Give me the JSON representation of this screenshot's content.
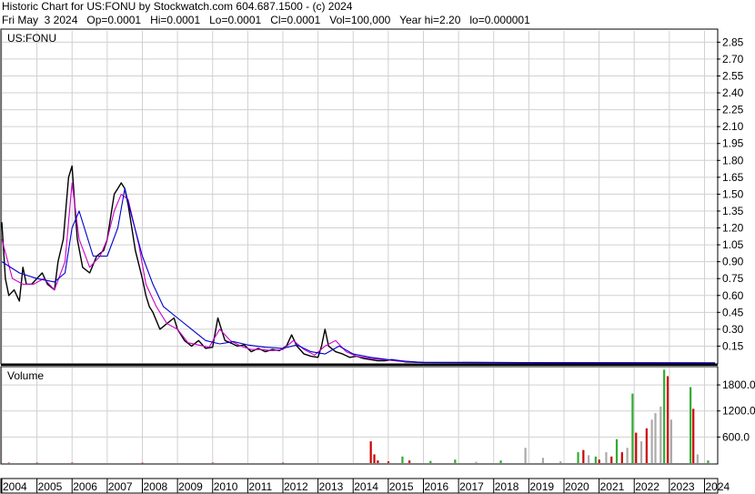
{
  "header": {
    "line1": "Historic Chart for US:FONU by Stockwatch.com 604.687.1500 - (c) 2024",
    "line2": "Fri May  3 2024   Op=0.0001   Hi=0.0001   Lo=0.0001   Cl=0.0001   Vol=100,000   Year hi=2.20   lo=0.000001"
  },
  "chart_data": {
    "type": "line",
    "price_panel": {
      "label": "US:FONU",
      "ylim": [
        0,
        2.95
      ],
      "yticks": [
        "0.15",
        "0.30",
        "0.45",
        "0.60",
        "0.75",
        "0.90",
        "1.05",
        "1.20",
        "1.35",
        "1.50",
        "1.65",
        "1.80",
        "1.95",
        "2.10",
        "2.25",
        "2.40",
        "2.55",
        "2.70",
        "2.85"
      ],
      "series": [
        {
          "key": "price",
          "color": "#000000",
          "x": [
            2004.0,
            2004.1,
            2004.2,
            2004.35,
            2004.5,
            2004.6,
            2004.7,
            2004.85,
            2005.0,
            2005.15,
            2005.3,
            2005.5,
            2005.6,
            2005.75,
            2005.9,
            2006.0,
            2006.1,
            2006.15,
            2006.3,
            2006.5,
            2006.7,
            2006.9,
            2007.0,
            2007.1,
            2007.2,
            2007.3,
            2007.4,
            2007.5,
            2007.6,
            2007.8,
            2008.0,
            2008.1,
            2008.2,
            2008.3,
            2008.5,
            2008.7,
            2008.9,
            2009.0,
            2009.2,
            2009.4,
            2009.6,
            2009.8,
            2010.0,
            2010.15,
            2010.25,
            2010.35,
            2010.5,
            2010.7,
            2010.9,
            2011.1,
            2011.3,
            2011.5,
            2011.7,
            2011.9,
            2012.1,
            2012.25,
            2012.4,
            2012.6,
            2012.8,
            2013.0,
            2013.1,
            2013.2,
            2013.3,
            2013.5,
            2013.7,
            2013.9,
            2014.1,
            2014.3,
            2014.5,
            2014.7,
            2014.9,
            2015.1,
            2015.3,
            2015.5,
            2016.0,
            2018.0,
            2020.0,
            2022.0,
            2024.3
          ],
          "y": [
            1.25,
            0.75,
            0.6,
            0.65,
            0.55,
            0.85,
            0.7,
            0.7,
            0.75,
            0.8,
            0.7,
            0.65,
            0.9,
            1.1,
            1.65,
            1.75,
            1.3,
            1.1,
            0.85,
            0.8,
            0.95,
            1.0,
            1.1,
            1.3,
            1.5,
            1.55,
            1.6,
            1.55,
            1.4,
            1.0,
            0.75,
            0.6,
            0.5,
            0.45,
            0.3,
            0.35,
            0.4,
            0.3,
            0.2,
            0.15,
            0.2,
            0.13,
            0.14,
            0.4,
            0.3,
            0.2,
            0.18,
            0.15,
            0.16,
            0.1,
            0.13,
            0.1,
            0.12,
            0.11,
            0.15,
            0.25,
            0.15,
            0.08,
            0.06,
            0.05,
            0.15,
            0.3,
            0.15,
            0.1,
            0.08,
            0.05,
            0.06,
            0.04,
            0.03,
            0.02,
            0.02,
            0.03,
            0.02,
            0.01,
            0.005,
            0.003,
            0.002,
            0.001,
            0.0001
          ]
        },
        {
          "key": "ma-short",
          "color": "#cc00cc",
          "x": [
            2004.0,
            2004.3,
            2004.6,
            2004.9,
            2005.2,
            2005.5,
            2005.8,
            2006.0,
            2006.2,
            2006.5,
            2006.8,
            2007.0,
            2007.2,
            2007.4,
            2007.6,
            2007.9,
            2008.1,
            2008.4,
            2008.7,
            2009.0,
            2009.3,
            2009.6,
            2009.9,
            2010.2,
            2010.5,
            2010.8,
            2011.1,
            2011.4,
            2011.7,
            2012.0,
            2012.3,
            2012.6,
            2012.9,
            2013.2,
            2013.5,
            2013.8,
            2014.1,
            2014.5,
            2014.9,
            2015.3,
            2016.0,
            2024.3
          ],
          "y": [
            1.1,
            0.75,
            0.7,
            0.7,
            0.75,
            0.65,
            0.9,
            1.6,
            1.1,
            0.85,
            0.95,
            1.1,
            1.35,
            1.5,
            1.45,
            1.05,
            0.7,
            0.5,
            0.35,
            0.3,
            0.18,
            0.16,
            0.14,
            0.3,
            0.2,
            0.15,
            0.12,
            0.12,
            0.11,
            0.12,
            0.2,
            0.12,
            0.07,
            0.15,
            0.2,
            0.1,
            0.06,
            0.04,
            0.03,
            0.015,
            0.005,
            0.0001
          ]
        },
        {
          "key": "ma-long",
          "color": "#0000cc",
          "x": [
            2004.0,
            2004.5,
            2005.0,
            2005.5,
            2005.8,
            2006.0,
            2006.2,
            2006.6,
            2007.0,
            2007.3,
            2007.5,
            2007.7,
            2008.0,
            2008.3,
            2008.6,
            2009.0,
            2009.4,
            2009.8,
            2010.2,
            2010.6,
            2011.0,
            2011.5,
            2012.0,
            2012.4,
            2012.8,
            2013.2,
            2013.6,
            2014.0,
            2014.5,
            2015.0,
            2015.5,
            2016.0,
            2024.3
          ],
          "y": [
            0.9,
            0.8,
            0.75,
            0.72,
            0.8,
            1.2,
            1.35,
            0.95,
            0.95,
            1.2,
            1.55,
            1.3,
            0.95,
            0.7,
            0.5,
            0.4,
            0.3,
            0.2,
            0.17,
            0.19,
            0.16,
            0.14,
            0.13,
            0.16,
            0.1,
            0.08,
            0.15,
            0.08,
            0.05,
            0.03,
            0.015,
            0.005,
            0.0001
          ]
        }
      ]
    },
    "volume_panel": {
      "label": "Volume",
      "ylim": [
        0,
        2200
      ],
      "yticks": [
        "600.0",
        "1200.0",
        "1800.0"
      ],
      "bars": [
        {
          "x": 2004.2,
          "v": 10,
          "color": "#cc0000"
        },
        {
          "x": 2005.0,
          "v": 8,
          "color": "#cc0000"
        },
        {
          "x": 2006.0,
          "v": 10,
          "color": "#cc0000"
        },
        {
          "x": 2008.0,
          "v": 8,
          "color": "#cc0000"
        },
        {
          "x": 2010.0,
          "v": 10,
          "color": "#cc0000"
        },
        {
          "x": 2012.0,
          "v": 8,
          "color": "#cc0000"
        },
        {
          "x": 2014.5,
          "v": 500,
          "color": "#cc0000"
        },
        {
          "x": 2014.6,
          "v": 200,
          "color": "#cc0000"
        },
        {
          "x": 2014.7,
          "v": 60,
          "color": "#cc0000"
        },
        {
          "x": 2015.0,
          "v": 40,
          "color": "#cc0000"
        },
        {
          "x": 2015.4,
          "v": 150,
          "color": "#33aa33"
        },
        {
          "x": 2015.6,
          "v": 60,
          "color": "#cc0000"
        },
        {
          "x": 2016.2,
          "v": 50,
          "color": "#33aa33"
        },
        {
          "x": 2016.9,
          "v": 80,
          "color": "#33aa33"
        },
        {
          "x": 2017.5,
          "v": 30,
          "color": "#aaaaaa"
        },
        {
          "x": 2018.2,
          "v": 60,
          "color": "#33aa33"
        },
        {
          "x": 2018.9,
          "v": 350,
          "color": "#aaaaaa"
        },
        {
          "x": 2019.4,
          "v": 120,
          "color": "#aaaaaa"
        },
        {
          "x": 2019.9,
          "v": 40,
          "color": "#aaaaaa"
        },
        {
          "x": 2020.4,
          "v": 250,
          "color": "#33aa33"
        },
        {
          "x": 2020.55,
          "v": 300,
          "color": "#cc0000"
        },
        {
          "x": 2020.7,
          "v": 180,
          "color": "#aaaaaa"
        },
        {
          "x": 2020.9,
          "v": 150,
          "color": "#33aa33"
        },
        {
          "x": 2021.0,
          "v": 80,
          "color": "#cc0000"
        },
        {
          "x": 2021.2,
          "v": 250,
          "color": "#aaaaaa"
        },
        {
          "x": 2021.35,
          "v": 150,
          "color": "#cc0000"
        },
        {
          "x": 2021.5,
          "v": 550,
          "color": "#33aa33"
        },
        {
          "x": 2021.65,
          "v": 250,
          "color": "#cc0000"
        },
        {
          "x": 2021.8,
          "v": 350,
          "color": "#aaaaaa"
        },
        {
          "x": 2021.95,
          "v": 1600,
          "color": "#33aa33"
        },
        {
          "x": 2022.05,
          "v": 700,
          "color": "#cc0000"
        },
        {
          "x": 2022.2,
          "v": 500,
          "color": "#aaaaaa"
        },
        {
          "x": 2022.35,
          "v": 800,
          "color": "#cc0000"
        },
        {
          "x": 2022.5,
          "v": 1000,
          "color": "#aaaaaa"
        },
        {
          "x": 2022.6,
          "v": 1150,
          "color": "#aaaaaa"
        },
        {
          "x": 2022.75,
          "v": 1300,
          "color": "#aaaaaa"
        },
        {
          "x": 2022.85,
          "v": 2150,
          "color": "#33aa33"
        },
        {
          "x": 2022.95,
          "v": 2000,
          "color": "#cc0000"
        },
        {
          "x": 2023.05,
          "v": 1000,
          "color": "#aaaaaa"
        },
        {
          "x": 2023.6,
          "v": 1750,
          "color": "#33aa33"
        },
        {
          "x": 2023.68,
          "v": 1250,
          "color": "#cc0000"
        },
        {
          "x": 2023.8,
          "v": 200,
          "color": "#aaaaaa"
        },
        {
          "x": 2024.1,
          "v": 60,
          "color": "#33aa33"
        }
      ]
    },
    "xaxis": {
      "xlim": [
        2004.0,
        2024.35
      ],
      "years": [
        "2004",
        "2005",
        "2006",
        "2007",
        "2008",
        "2009",
        "2010",
        "2011",
        "2012",
        "2013",
        "2014",
        "2015",
        "2016",
        "2017",
        "2018",
        "2019",
        "2020",
        "2021",
        "2022",
        "2023",
        "2024"
      ]
    }
  }
}
